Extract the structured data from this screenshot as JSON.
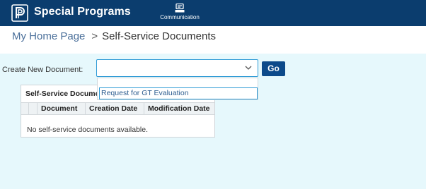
{
  "header": {
    "app_title": "Special Programs",
    "nav": [
      {
        "label": "Communication",
        "icon": "communication-icon"
      }
    ],
    "colors": {
      "bar": "#0b3d6e",
      "text": "#ffffff"
    }
  },
  "breadcrumb": {
    "home": "My Home Page",
    "separator": ">",
    "current": "Self-Service Documents"
  },
  "create_document": {
    "label": "Create New Document:",
    "selected_value": "",
    "go_label": "Go",
    "dropdown_options": [
      "Request for GT Evaluation"
    ],
    "dropdown_icon": "chevron-down-icon"
  },
  "documents_table": {
    "title": "Self-Service Documents",
    "columns": [
      "Document",
      "Creation Date",
      "Modification Date"
    ],
    "rows": [],
    "empty_message": "No self-service documents available."
  },
  "colors": {
    "panel_bg": "#e6f8fc",
    "accent": "#2f9bd6",
    "button": "#0c4a8a"
  }
}
